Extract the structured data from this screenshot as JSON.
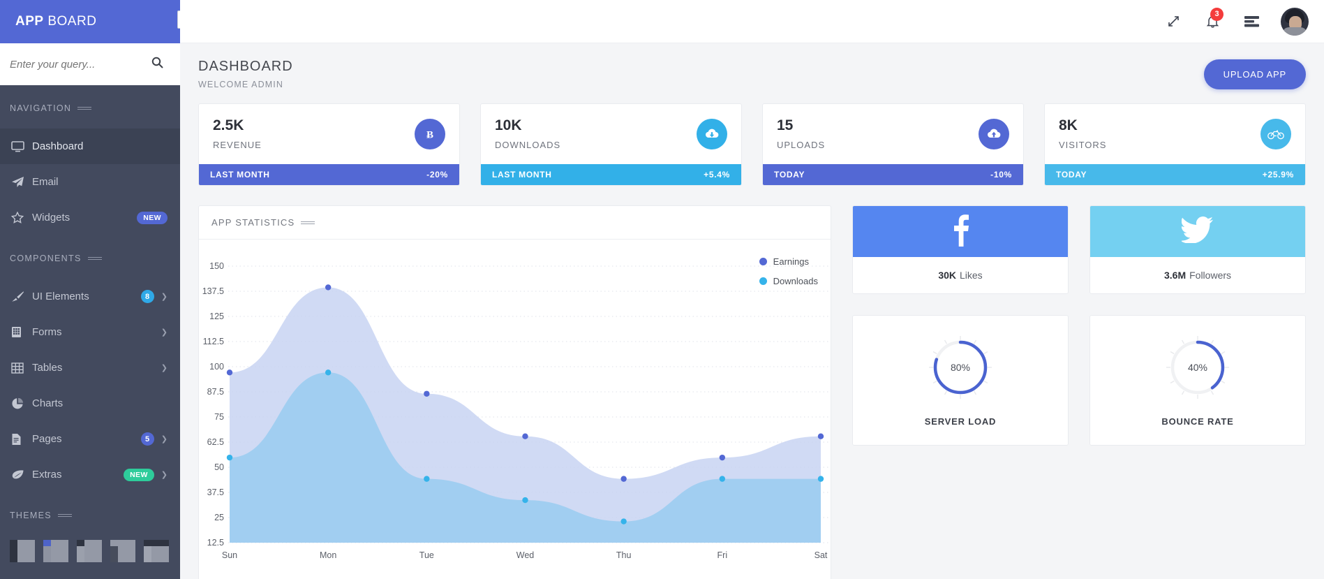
{
  "brand": {
    "bold": "APP",
    "light": "BOARD",
    "collapse_icon": "sidebar-toggle-icon"
  },
  "search": {
    "placeholder": "Enter your query...",
    "value": "",
    "icon": "search-icon"
  },
  "sidebar": {
    "sections": [
      {
        "title": "NAVIGATION"
      },
      {
        "title": "COMPONENTS"
      },
      {
        "title": "THEMES"
      }
    ],
    "nav_items": [
      {
        "label": "Dashboard",
        "icon": "monitor-icon",
        "active": true
      },
      {
        "label": "Email",
        "icon": "paper-plane-icon",
        "active": false
      },
      {
        "label": "Widgets",
        "icon": "star-icon",
        "active": false,
        "badge": "NEW",
        "badge_color": "#5368d4"
      }
    ],
    "component_items": [
      {
        "label": "UI Elements",
        "icon": "brush-icon",
        "badge": "8",
        "badge_color": "#2fa9e8",
        "badge_round": true,
        "chevron": true
      },
      {
        "label": "Forms",
        "icon": "form-icon",
        "chevron": true
      },
      {
        "label": "Tables",
        "icon": "table-icon",
        "chevron": true
      },
      {
        "label": "Charts",
        "icon": "pie-chart-icon",
        "chevron": false
      },
      {
        "label": "Pages",
        "icon": "file-icon",
        "badge": "5",
        "badge_color": "#5368d4",
        "badge_round": true,
        "chevron": true
      },
      {
        "label": "Extras",
        "icon": "leaf-icon",
        "badge": "NEW",
        "badge_color": "#2ecc9b",
        "chevron": true
      }
    ],
    "themes": [
      {
        "name": "theme-1"
      },
      {
        "name": "theme-2"
      },
      {
        "name": "theme-3"
      },
      {
        "name": "theme-4"
      },
      {
        "name": "theme-5"
      }
    ]
  },
  "topbar": {
    "icons": [
      {
        "name": "expand-icon"
      },
      {
        "name": "bell-icon",
        "badge": "3",
        "badge_color": "#f43c3c"
      },
      {
        "name": "menu-list-icon"
      }
    ],
    "avatar": "user-avatar"
  },
  "page": {
    "title": "DASHBOARD",
    "subtitle": "WELCOME ADMIN",
    "upload_label": "UPLOAD APP"
  },
  "stats": [
    {
      "value": "2.5K",
      "label": "REVENUE",
      "icon": "bitcoin-icon",
      "icon_glyph": "Ƀ",
      "color": "#5368d4",
      "period": "LAST MONTH",
      "delta": "-20%"
    },
    {
      "value": "10K",
      "label": "DOWNLOADS",
      "icon": "cloud-download-icon",
      "icon_glyph": "",
      "color": "#32b0e8",
      "period": "LAST MONTH",
      "delta": "+5.4%"
    },
    {
      "value": "15",
      "label": "UPLOADS",
      "icon": "cloud-upload-icon",
      "icon_glyph": "",
      "color": "#5368d4",
      "period": "TODAY",
      "delta": "-10%"
    },
    {
      "value": "8K",
      "label": "VISITORS",
      "icon": "bicycle-icon",
      "icon_glyph": "",
      "color": "#47b9ea",
      "period": "TODAY",
      "delta": "+25.9%"
    }
  ],
  "chart_card": {
    "title": "APP STATISTICS"
  },
  "chart_data": {
    "type": "area",
    "title": "APP STATISTICS",
    "xlabel": "",
    "ylabel": "",
    "grid": true,
    "legend_position": "top-right",
    "categories": [
      "Sun",
      "Mon",
      "Tue",
      "Wed",
      "Thu",
      "Fri",
      "Sat"
    ],
    "ytick_labels": [
      "150",
      "137.5",
      "125",
      "112.5",
      "100",
      "87.5",
      "75",
      "62.5",
      "50",
      "37.5",
      "25",
      "12.5"
    ],
    "ylim": [
      0,
      162.5
    ],
    "series": [
      {
        "name": "Earnings",
        "color": "#5368d4",
        "fill": "#c8d3f2",
        "values": [
          100,
          150,
          87.5,
          62.5,
          37.5,
          50,
          62.5
        ]
      },
      {
        "name": "Downloads",
        "color": "#35b3ea",
        "fill": "#9ecdf0",
        "values": [
          50,
          100,
          37.5,
          25,
          12.5,
          37.5,
          37.5
        ]
      }
    ]
  },
  "social": [
    {
      "name": "facebook",
      "icon": "facebook-icon",
      "color": "#5586f0",
      "count": "30K",
      "label": "Likes"
    },
    {
      "name": "twitter",
      "icon": "twitter-icon",
      "color": "#74d0f1",
      "count": "3.6M",
      "label": "Followers"
    }
  ],
  "gauges": [
    {
      "value": "80%",
      "percent": 80,
      "label": "SERVER LOAD",
      "color": "#4a63d0"
    },
    {
      "value": "40%",
      "percent": 40,
      "label": "BOUNCE RATE",
      "color": "#4a63d0"
    }
  ]
}
